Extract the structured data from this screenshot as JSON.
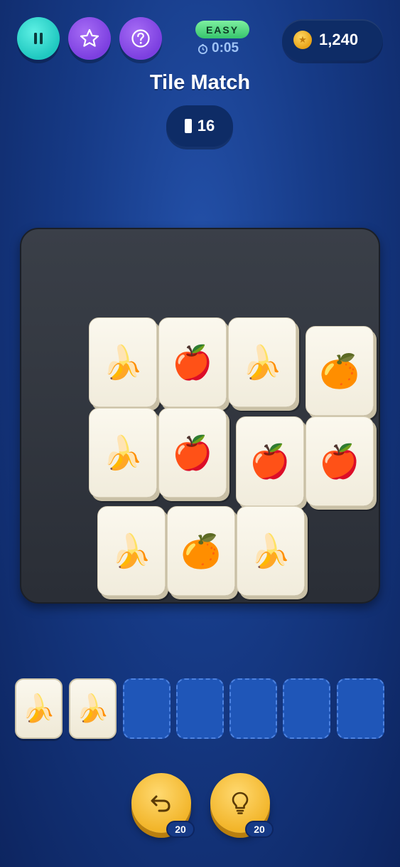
{
  "header": {
    "difficulty": "EASY",
    "timer": "0:05",
    "coins": "1,240",
    "title": "Tile Match",
    "tiles_remaining": "16"
  },
  "icons": {
    "pause": "pause-icon",
    "star": "star-icon",
    "help": "help-icon",
    "clock": "clock-icon",
    "coin": "coin-icon",
    "tile": "tile-icon",
    "undo": "undo-icon",
    "hint": "lightbulb-icon"
  },
  "colors": {
    "background": "#163a86",
    "pause_button": "#1fc8c0",
    "purple_button": "#7c3fe0",
    "difficulty_badge": "#36c46c",
    "board": "#2e323a",
    "tile_face": "#f7f3e6",
    "tray_slot_empty": "#1f56b8",
    "power_button": "#f2b52a"
  },
  "board": {
    "tiles": [
      {
        "fruit": "banana",
        "glyph": "🍌"
      },
      {
        "fruit": "apple",
        "glyph": "🍎"
      },
      {
        "fruit": "banana",
        "glyph": "🍌"
      },
      {
        "fruit": "orange",
        "glyph": "🍊"
      },
      {
        "fruit": "banana",
        "glyph": "🍌"
      },
      {
        "fruit": "apple",
        "glyph": "🍎"
      },
      {
        "fruit": "apple",
        "glyph": "🍎"
      },
      {
        "fruit": "apple",
        "glyph": "🍎"
      },
      {
        "fruit": "banana",
        "glyph": "🍌"
      },
      {
        "fruit": "orange",
        "glyph": "🍊"
      },
      {
        "fruit": "banana",
        "glyph": "🍌"
      }
    ]
  },
  "tray": {
    "capacity": 7,
    "slots": [
      {
        "fruit": "banana",
        "glyph": "🍌"
      },
      {
        "fruit": "banana",
        "glyph": "🍌"
      },
      {
        "fruit": "",
        "glyph": ""
      },
      {
        "fruit": "",
        "glyph": ""
      },
      {
        "fruit": "",
        "glyph": ""
      },
      {
        "fruit": "",
        "glyph": ""
      },
      {
        "fruit": "",
        "glyph": ""
      }
    ]
  },
  "powerups": {
    "undo_count": "20",
    "hint_count": "20"
  }
}
